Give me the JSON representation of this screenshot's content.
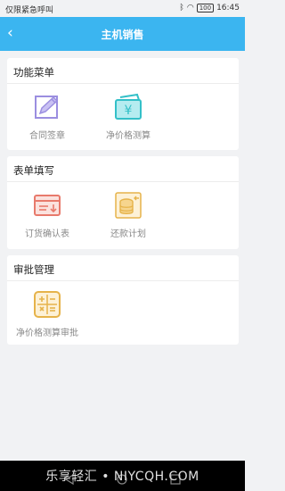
{
  "status_bar": {
    "carrier": "仅限紧急呼叫",
    "battery": "100",
    "time": "16:45"
  },
  "header": {
    "title": "主机销售",
    "back_icon": "chevron-left-icon"
  },
  "sections": [
    {
      "title": "功能菜单",
      "items": [
        {
          "label": "合同签章",
          "icon": "pen-edit-icon"
        },
        {
          "label": "净价格测算",
          "icon": "yen-wallet-icon"
        }
      ]
    },
    {
      "title": "表单填写",
      "items": [
        {
          "label": "订货确认表",
          "icon": "order-form-icon"
        },
        {
          "label": "还款计划",
          "icon": "coin-stack-icon"
        }
      ]
    },
    {
      "title": "审批管理",
      "items": [
        {
          "label": "净价格测算审批",
          "icon": "calculator-icon"
        }
      ]
    }
  ],
  "watermark": "乐享轻汇 • NIYCQH.COM",
  "colors": {
    "header": "#3bb5f0",
    "purple": "#9b8ee0",
    "teal": "#33c0c8",
    "red": "#e87a6c",
    "gold": "#e6b34a"
  }
}
